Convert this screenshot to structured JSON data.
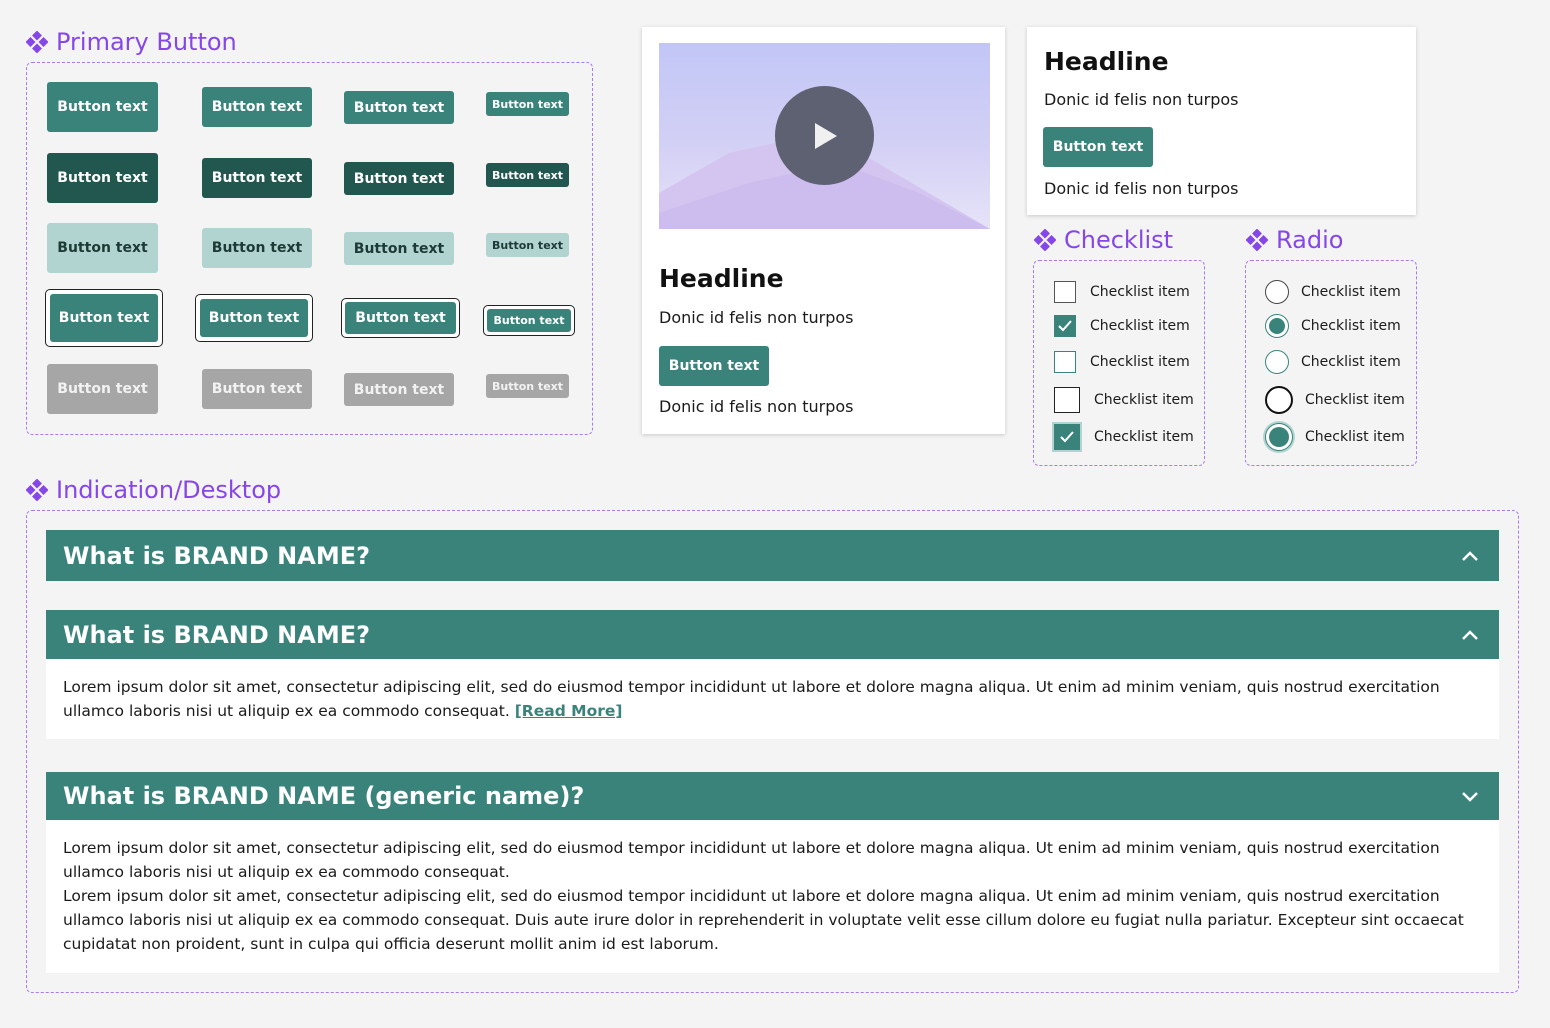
{
  "sections": {
    "primary_button": "Primary Button",
    "checklist": "Checklist",
    "radio": "Radio",
    "indication": "Indication/Desktop"
  },
  "colors": {
    "accent_purple": "#8547e8",
    "primary_teal": "#3a837b",
    "dark_teal": "#21574f",
    "light_teal": "#b1d4d0",
    "disabled_gray": "#a6a6a6"
  },
  "button_grid": {
    "label": "Button text"
  },
  "video_card": {
    "play_icon": "play-icon",
    "headline": "Headline",
    "text_top": "Donic id felis non turpos",
    "button": "Button text",
    "text_bottom": "Donic id felis non turpos"
  },
  "text_card": {
    "headline": "Headline",
    "text_top": "Donic id felis non turpos",
    "button": "Button text",
    "text_bottom": "Donic id felis non turpos"
  },
  "checklist": {
    "items": [
      {
        "label": "Checklist item",
        "checked": false
      },
      {
        "label": "Checklist item",
        "checked": true
      },
      {
        "label": "Checklist item",
        "checked": false
      },
      {
        "label": "Checklist item",
        "checked": false
      },
      {
        "label": "Checklist item",
        "checked": true
      }
    ]
  },
  "radio": {
    "items": [
      {
        "label": "Checklist item",
        "selected": false
      },
      {
        "label": "Checklist item",
        "selected": true
      },
      {
        "label": "Checklist item",
        "selected": false
      },
      {
        "label": "Checklist item",
        "selected": false
      },
      {
        "label": "Checklist item",
        "selected": true
      }
    ]
  },
  "accordion": {
    "items": [
      {
        "title": "What is BRAND NAME?",
        "expanded": false
      },
      {
        "title": "What is BRAND NAME?",
        "expanded": true,
        "body": "Lorem ipsum dolor sit amet, consectetur adipiscing elit, sed do eiusmod tempor incididunt ut labore et dolore magna aliqua. Ut enim ad minim veniam, quis nostrud exercitation ullamco laboris nisi ut aliquip ex ea commodo consequat.",
        "link": "[Read More]"
      },
      {
        "title": "What is BRAND NAME (generic name)?",
        "expanded": true,
        "body_1": "Lorem ipsum dolor sit amet, consectetur adipiscing elit, sed do eiusmod tempor incididunt ut labore et dolore magna aliqua. Ut enim ad minim veniam, quis nostrud exercitation ullamco laboris nisi ut aliquip ex ea commodo consequat.",
        "body_2": "Lorem ipsum dolor sit amet, consectetur adipiscing elit, sed do eiusmod tempor incididunt ut labore et dolore magna aliqua. Ut enim ad minim veniam, quis nostrud exercitation ullamco laboris nisi ut aliquip ex ea commodo consequat. Duis aute irure dolor in reprehenderit in voluptate velit esse cillum dolore eu fugiat nulla pariatur. Excepteur sint occaecat cupidatat non proident, sunt in culpa qui officia deserunt mollit anim id est laborum."
      }
    ]
  }
}
